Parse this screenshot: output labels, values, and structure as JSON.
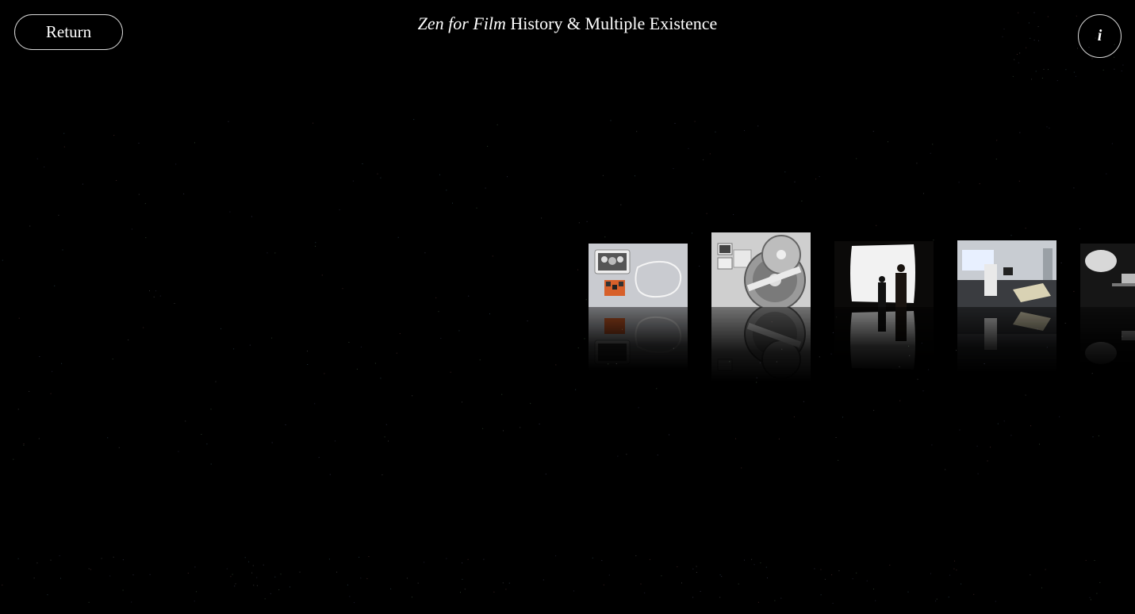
{
  "header": {
    "return_label": "Return",
    "title_italic": "Zen for Film",
    "title_rest": " History & Multiple Existence",
    "info_label": "i"
  },
  "gallery": {
    "items": [
      {
        "name": "gallery-item-box-set-and-film",
        "icon": "box-set-photo"
      },
      {
        "name": "gallery-item-film-reel",
        "icon": "film-reel-photo"
      },
      {
        "name": "gallery-item-projection-viewers",
        "icon": "projection-silhouettes-photo"
      },
      {
        "name": "gallery-item-installation-view",
        "icon": "installation-photo"
      },
      {
        "name": "gallery-item-projector",
        "icon": "projector-photo"
      }
    ]
  },
  "colors": {
    "background": "#000000",
    "text": "#ffffff",
    "button_border": "#d8d8d8"
  }
}
